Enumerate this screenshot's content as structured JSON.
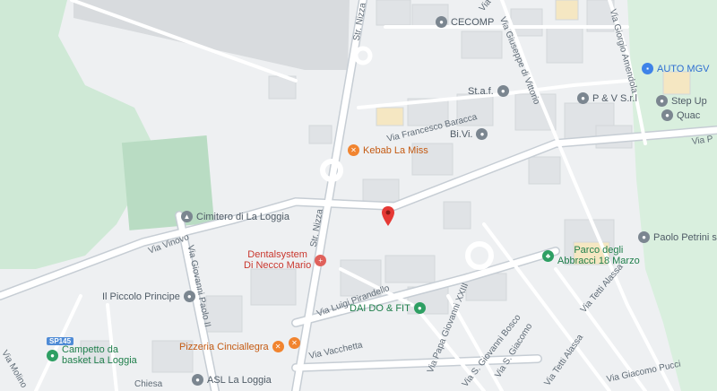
{
  "map": {
    "colors": {
      "road": "#ffffff",
      "road_casing": "#c6cdd4",
      "park": "#cfe9d6",
      "building": "#e2e5e8",
      "marker": "#e53935"
    },
    "pois": [
      {
        "name": "CECOMP",
        "color": "gray",
        "icon": "pin-icon"
      },
      {
        "name": "AUTO MGV",
        "color": "blue",
        "icon": "shopping-bag-icon"
      },
      {
        "name": "Step Up",
        "color": "gray",
        "icon": "pin-icon"
      },
      {
        "name": "Quac",
        "color": "gray",
        "icon": "pin-icon"
      },
      {
        "name": "P & V S.r.l",
        "color": "gray",
        "icon": "pin-icon"
      },
      {
        "name": "St.a.f.",
        "color": "gray",
        "icon": "pin-icon"
      },
      {
        "name": "Bi.Vi.",
        "color": "gray",
        "icon": "pin-icon"
      },
      {
        "name": "Kebab La Miss",
        "color": "orange",
        "icon": "fork-knife-icon"
      },
      {
        "name": "Cimitero di La Loggia",
        "color": "gray",
        "icon": "cemetery-icon"
      },
      {
        "name": "Dentalsystem",
        "name2": "Di Necco Mario",
        "color": "red",
        "icon": "medical-cross-icon"
      },
      {
        "name": "Paolo Petrini s.r.l",
        "color": "gray",
        "icon": "pin-icon"
      },
      {
        "name": "Parco degli",
        "name2": "Abbracci 18 Marzo",
        "color": "green",
        "icon": "tree-icon"
      },
      {
        "name": "Il Piccolo Principe",
        "color": "gray",
        "icon": "school-icon"
      },
      {
        "name": "DAI DO & FIT",
        "color": "green",
        "icon": "fitness-icon"
      },
      {
        "name": "Campetto da",
        "name2": "basket La Loggia",
        "color": "green",
        "icon": "basketball-icon"
      },
      {
        "name": "Pizzeria Cinciallegra",
        "color": "orange",
        "icon": "fork-knife-icon"
      },
      {
        "name": "ASL La Loggia",
        "color": "gray",
        "icon": "hospital-icon"
      }
    ],
    "streets": [
      "Str. Nizza",
      "Str. Nizza",
      "Via Ronco",
      "Via Giuseppe di Vittorio",
      "Via Giorgio Amendola",
      "Via Francesco Baracca",
      "Via P",
      "Via Vinovo",
      "Via Giovanni Paolo II",
      "Via Luigi Pirandello",
      "Via Vacchetta",
      "Via Papa Giovanni XXIII",
      "Via S. Giacomo",
      "Via S. Giovanni Bosco",
      "Via Tetti Alassa",
      "Via Tetti Alassa",
      "Via Giacomo Pucci",
      "Via Molino",
      "Chiesa"
    ],
    "shield": "SP145",
    "marker_label": "Selected location"
  }
}
